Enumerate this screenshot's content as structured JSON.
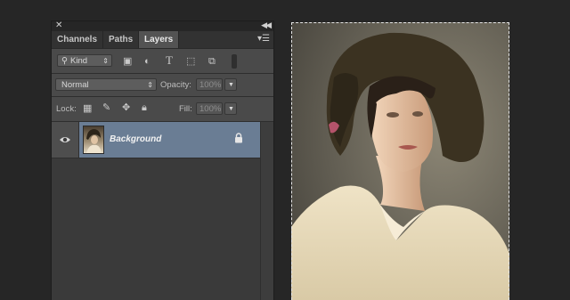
{
  "panel": {
    "tabs": [
      {
        "label": "Channels"
      },
      {
        "label": "Paths"
      },
      {
        "label": "Layers"
      }
    ],
    "filter": {
      "kind_label": "Kind"
    },
    "blend": {
      "mode": "Normal",
      "opacity_label": "Opacity:",
      "opacity_value": "100%"
    },
    "lock": {
      "label": "Lock:",
      "fill_label": "Fill:",
      "fill_value": "100%"
    },
    "layers": [
      {
        "name": "Background"
      }
    ]
  },
  "icons": {
    "close": "close-icon",
    "collapse": "double-chevron-icon",
    "panel_menu": "panel-menu-icon",
    "search": "search-icon",
    "visibility": "eye-icon",
    "lock": "lock-icon"
  },
  "colors": {
    "app_bg": "#262626",
    "panel_bg": "#3a3a3a",
    "selected_layer": "#6a7d94"
  }
}
